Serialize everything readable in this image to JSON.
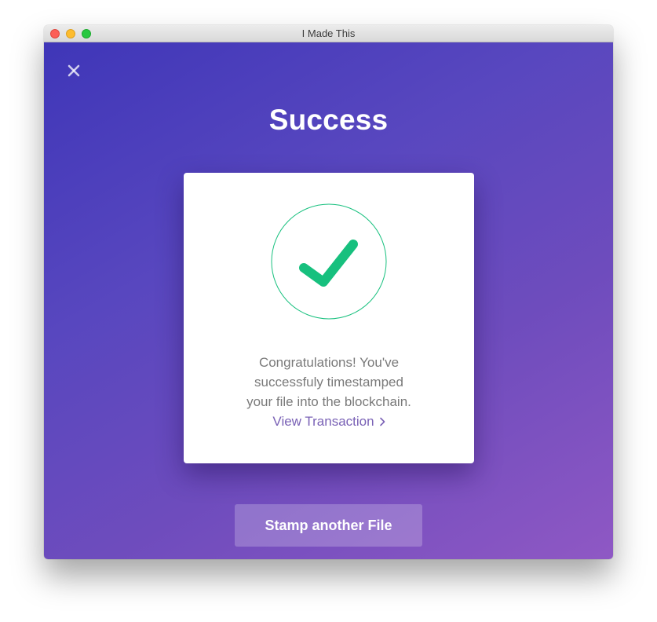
{
  "window": {
    "title": "I Made This"
  },
  "page": {
    "title": "Success"
  },
  "card": {
    "message_line1": "Congratulations! You've",
    "message_line2": "successfuly timestamped",
    "message_line3": "your file into the blockchain.",
    "link_label": "View Transaction",
    "icons": {
      "check": "checkmark-icon",
      "chevron": "chevron-right-icon"
    }
  },
  "actions": {
    "stamp_label": "Stamp another File"
  },
  "icons": {
    "close": "close-icon"
  },
  "colors": {
    "gradient_start": "#3f36b8",
    "gradient_end": "#8f58c4",
    "check_green": "#17c07e",
    "link_purple": "#7a62b6"
  }
}
